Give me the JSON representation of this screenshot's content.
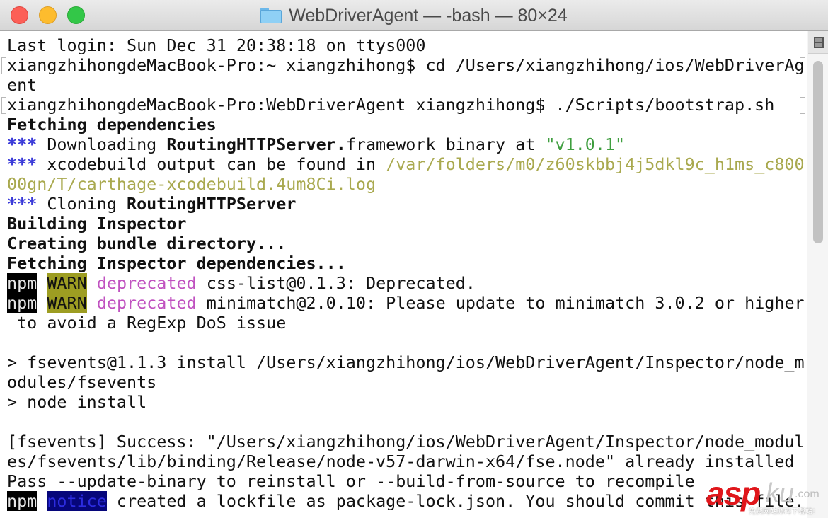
{
  "window": {
    "title": "WebDriverAgent — -bash — 80×24",
    "icon": "folder-icon",
    "buttons": [
      "close",
      "minimize",
      "maximize"
    ]
  },
  "terminal": {
    "columns": 80,
    "rows": 24,
    "lines": [
      {
        "segments": [
          {
            "text": "Last login: Sun Dec 31 20:38:18 on ttys000",
            "style": ""
          }
        ]
      },
      {
        "marked": true,
        "segments": [
          {
            "text": "xiangzhihongdeMacBook-Pro:~ xiangzhihong$ cd /Users/xiangzhihong/ios/WebDriverAg",
            "style": ""
          }
        ]
      },
      {
        "segments": [
          {
            "text": "ent",
            "style": ""
          }
        ]
      },
      {
        "marked": true,
        "segments": [
          {
            "text": "xiangzhihongdeMacBook-Pro:WebDriverAgent xiangzhihong$ ./Scripts/bootstrap.sh",
            "style": ""
          }
        ]
      },
      {
        "segments": [
          {
            "text": "Fetching dependencies",
            "style": "b"
          }
        ]
      },
      {
        "segments": [
          {
            "text": "***",
            "style": "blue b"
          },
          {
            "text": " Downloading ",
            "style": ""
          },
          {
            "text": "RoutingHTTPServer.",
            "style": "b"
          },
          {
            "text": "framework binary at ",
            "style": ""
          },
          {
            "text": "\"v1.0.1\"",
            "style": "green"
          }
        ]
      },
      {
        "segments": [
          {
            "text": "***",
            "style": "blue b"
          },
          {
            "text": " xcodebuild output can be found in ",
            "style": ""
          },
          {
            "text": "/var/folders/m0/z60skbbj4j5dkl9c_h1ms_c800",
            "style": "olive"
          }
        ]
      },
      {
        "segments": [
          {
            "text": "00gn/T/carthage-xcodebuild.4um8Ci.log",
            "style": "olive"
          }
        ]
      },
      {
        "segments": [
          {
            "text": "***",
            "style": "blue b"
          },
          {
            "text": " Cloning ",
            "style": ""
          },
          {
            "text": "RoutingHTTPServer",
            "style": "b"
          }
        ]
      },
      {
        "segments": [
          {
            "text": "Building Inspector",
            "style": "b"
          }
        ]
      },
      {
        "segments": [
          {
            "text": "Creating bundle directory...",
            "style": "b"
          }
        ]
      },
      {
        "segments": [
          {
            "text": "Fetching Inspector dependencies...",
            "style": "b"
          }
        ]
      },
      {
        "segments": [
          {
            "text": "npm",
            "style": "npm"
          },
          {
            "text": " ",
            "style": ""
          },
          {
            "text": "WARN",
            "style": "warn"
          },
          {
            "text": " ",
            "style": ""
          },
          {
            "text": "deprecated",
            "style": "magenta"
          },
          {
            "text": " css-list@0.1.3: Deprecated.",
            "style": ""
          }
        ]
      },
      {
        "segments": [
          {
            "text": "npm",
            "style": "npm"
          },
          {
            "text": " ",
            "style": ""
          },
          {
            "text": "WARN",
            "style": "warn"
          },
          {
            "text": " ",
            "style": ""
          },
          {
            "text": "deprecated",
            "style": "magenta"
          },
          {
            "text": " minimatch@2.0.10: Please update to minimatch 3.0.2 or higher",
            "style": ""
          }
        ]
      },
      {
        "segments": [
          {
            "text": " to avoid a RegExp DoS issue",
            "style": ""
          }
        ]
      },
      {
        "segments": [
          {
            "text": "",
            "style": ""
          }
        ]
      },
      {
        "segments": [
          {
            "text": "> fsevents@1.1.3 install /Users/xiangzhihong/ios/WebDriverAgent/Inspector/node_m",
            "style": ""
          }
        ]
      },
      {
        "segments": [
          {
            "text": "odules/fsevents",
            "style": ""
          }
        ]
      },
      {
        "segments": [
          {
            "text": "> node install",
            "style": ""
          }
        ]
      },
      {
        "segments": [
          {
            "text": "",
            "style": ""
          }
        ]
      },
      {
        "segments": [
          {
            "text": "[fsevents] Success: \"/Users/xiangzhihong/ios/WebDriverAgent/Inspector/node_modul",
            "style": ""
          }
        ]
      },
      {
        "segments": [
          {
            "text": "es/fsevents/lib/binding/Release/node-v57-darwin-x64/fse.node\" already installed",
            "style": ""
          }
        ]
      },
      {
        "segments": [
          {
            "text": "Pass --update-binary to reinstall or --build-from-source to recompile",
            "style": ""
          }
        ]
      },
      {
        "segments": [
          {
            "text": "npm",
            "style": "npm"
          },
          {
            "text": " ",
            "style": ""
          },
          {
            "text": "notice",
            "style": "notice"
          },
          {
            "text": " created a lockfile as package-lock.json. You should commit this file.",
            "style": ""
          }
        ]
      }
    ]
  },
  "watermark": {
    "brand": "asp",
    "brand_suffix": "ku",
    "domain": ".com",
    "tagline": "免费网站源码下载站!"
  },
  "colors": {
    "ansi_blue": "#3b3bd8",
    "ansi_green": "#3f9e3f",
    "ansi_olive": "#a9a94f",
    "ansi_magenta": "#c052c0",
    "warn_bg": "#9d9d22",
    "notice_bg": "#06067a",
    "watermark_red": "#e0161b"
  }
}
